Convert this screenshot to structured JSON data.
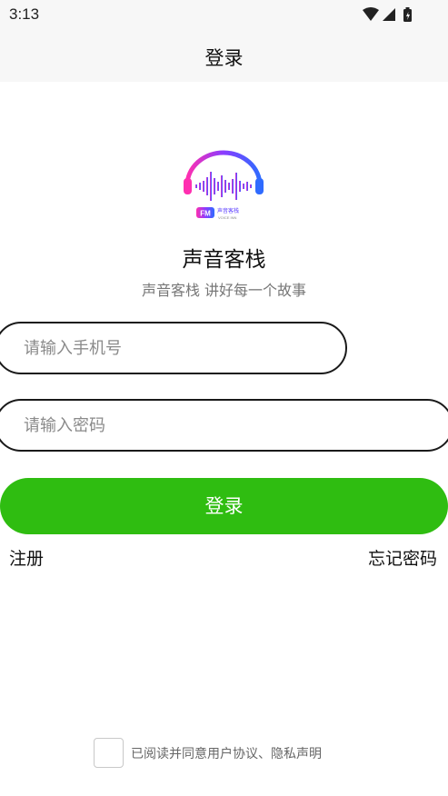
{
  "status_bar": {
    "time": "3:13",
    "icons": [
      "wifi-icon",
      "signal-icon",
      "battery-icon"
    ]
  },
  "header": {
    "title": "登录"
  },
  "logo": {
    "badge": "FM",
    "cn_text": "声音客栈",
    "en_text": "VOICE INN",
    "gradient_colors": [
      "#ff2fb0",
      "#8a3cff",
      "#2f6bff"
    ]
  },
  "app": {
    "name": "声音客栈",
    "slogan": "声音客栈 讲好每一个故事"
  },
  "form": {
    "phone_placeholder": "请输入手机号",
    "phone_value": "",
    "password_placeholder": "请输入密码",
    "password_value": "",
    "login_label": "登录"
  },
  "links": {
    "register": "注册",
    "forgot_password": "忘记密码"
  },
  "agreement": {
    "checked": false,
    "text": "已阅读并同意用户协议、隐私声明"
  },
  "colors": {
    "primary_green": "#2fbd11",
    "header_bg": "#f7f7f7"
  }
}
